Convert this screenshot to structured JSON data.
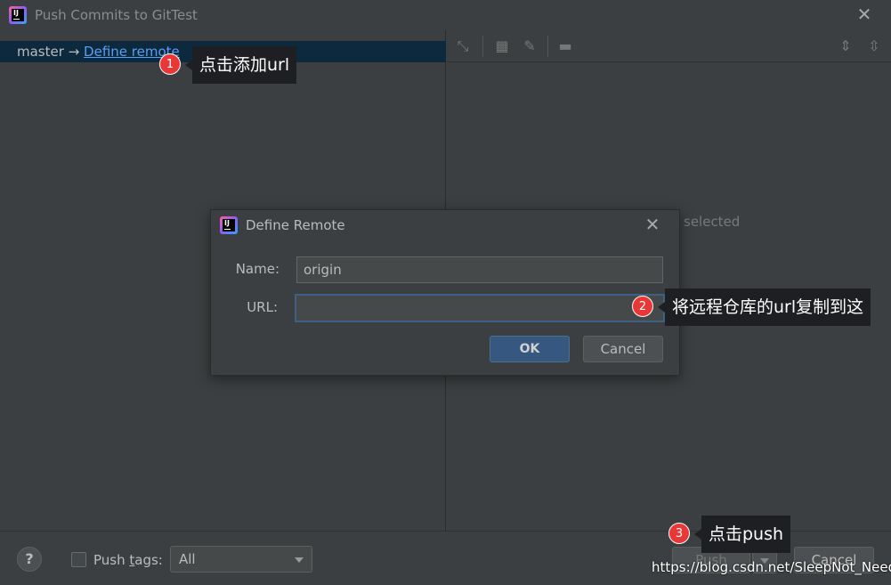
{
  "window": {
    "title": "Push Commits to GitTest",
    "app_icon_text": "IJ"
  },
  "left": {
    "branch": "master",
    "arrow": "→",
    "define_link": "Define remote"
  },
  "right": {
    "empty_text": "selected"
  },
  "modal": {
    "title": "Define Remote",
    "icon_text": "IJ",
    "name_label": "Name:",
    "name_value": "origin",
    "url_label": "URL:",
    "url_value": "",
    "ok": "OK",
    "cancel": "Cancel"
  },
  "bottom": {
    "help": "?",
    "push_tags_prefix": "Push ",
    "push_tags_underlined": "t",
    "push_tags_suffix": "ags:",
    "tags_selected": "All",
    "push": "Push",
    "cancel": "Cancel"
  },
  "annotations": [
    {
      "badge": "1",
      "text": "点击添加url"
    },
    {
      "badge": "2",
      "text": "将远程仓库的url复制到这"
    },
    {
      "badge": "3",
      "text": "点击push"
    }
  ],
  "watermark": "https://blog.csdn.net/SleepNot_Need",
  "colors": {
    "link": "#589df6",
    "selection": "#0d293e",
    "ok_button": "#365880",
    "badge": "#e93636"
  }
}
